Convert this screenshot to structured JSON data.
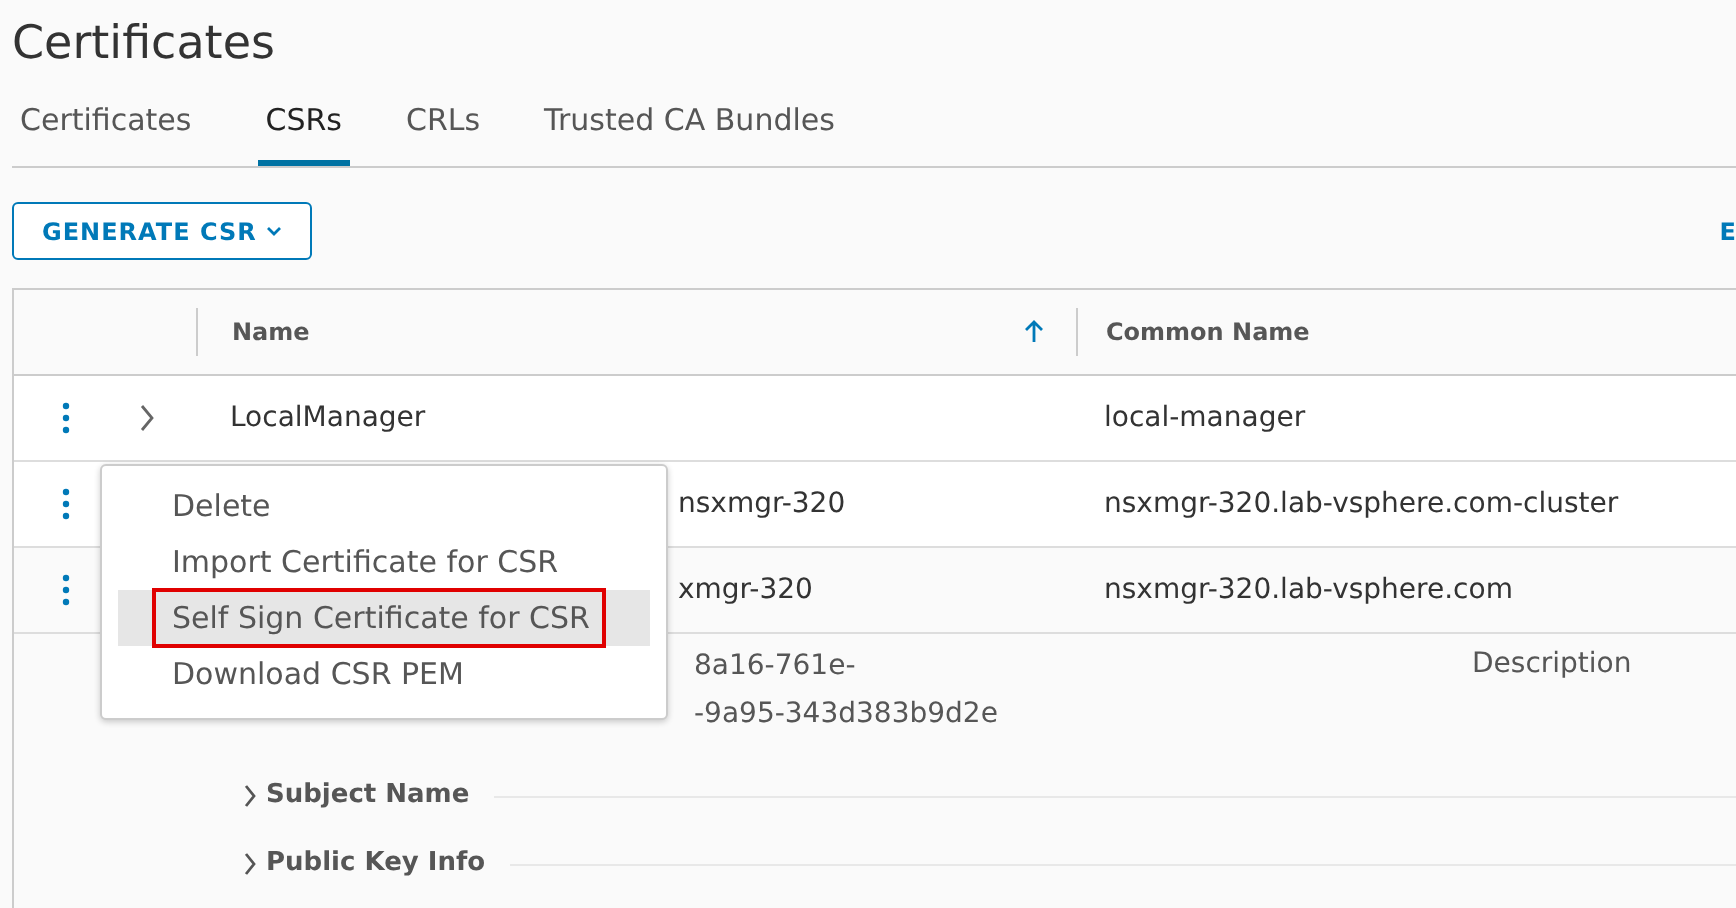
{
  "title": "Certificates",
  "tabs": [
    {
      "label": "Certificates",
      "selected": false
    },
    {
      "label": "CSRs",
      "selected": true
    },
    {
      "label": "CRLs",
      "selected": false
    },
    {
      "label": "Trusted CA Bundles",
      "selected": false
    }
  ],
  "toolbar": {
    "generate_button": "GENERATE CSR",
    "cut_button": "E"
  },
  "table": {
    "columns": [
      {
        "label": "Name",
        "sorted": true
      },
      {
        "label": "Common Name",
        "sorted": false
      }
    ],
    "rows": [
      {
        "name": "LocalManager",
        "common_name": "local-manager",
        "expanded": false,
        "has_toggle": true
      },
      {
        "name": "nsxmgr-320",
        "common_name": "nsxmgr-320.lab-vsphere.com-cluster",
        "expanded": false,
        "has_toggle": false
      },
      {
        "name": "xmgr-320",
        "common_name": "nsxmgr-320.lab-vsphere.com",
        "expanded": true,
        "has_toggle": false
      }
    ],
    "detail": {
      "id_lines": [
        "8a16-761e-",
        "-9a95-343d383b9d2e"
      ],
      "description_label": "Description",
      "sections": [
        {
          "label": "Subject Name",
          "expanded": false
        },
        {
          "label": "Public Key Info",
          "expanded": false
        }
      ]
    }
  },
  "context_menu": {
    "items": [
      {
        "label": "Delete",
        "highlighted": false
      },
      {
        "label": "Import Certificate for CSR",
        "highlighted": false
      },
      {
        "label": "Self Sign Certificate for CSR",
        "highlighted": true
      },
      {
        "label": "Download CSR PEM",
        "highlighted": false
      }
    ]
  }
}
